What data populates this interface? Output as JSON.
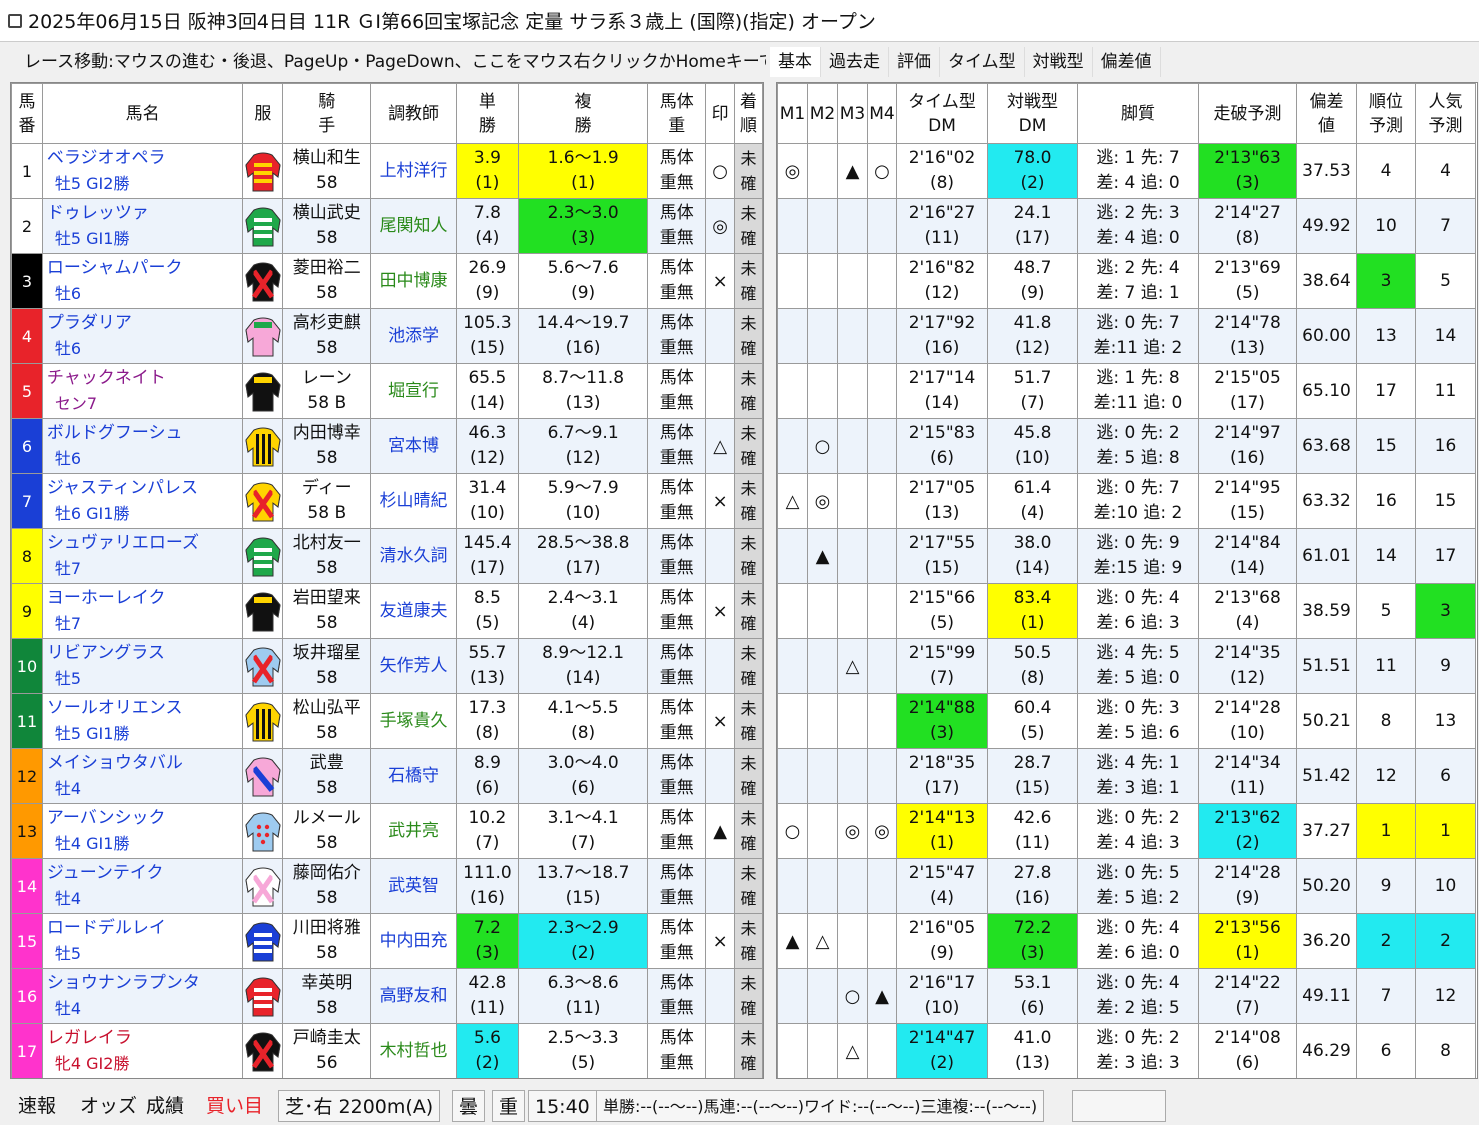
{
  "window": {
    "title": "2025年06月15日 阪神3回4日目 11R ＧⅠ第66回宝塚記念 定量 サラ系３歳上 (国際)(指定) オープン"
  },
  "toolbar": {
    "nav_hint": "レース移動:マウスの進む・後退、PageUp・PageDown、ここをマウス右クリックかHomeキーでレース選択",
    "tabs": [
      "基本",
      "過去走",
      "評価",
      "タイム型",
      "対戦型",
      "偏差値"
    ],
    "active_tab": "基本"
  },
  "left_headers": [
    "馬番",
    "馬名",
    "服",
    "騎手",
    "調教師",
    "単勝",
    "複勝",
    "馬体重",
    "印",
    "着順"
  ],
  "right_headers": [
    "M1",
    "M2",
    "M3",
    "M4",
    "タイム型DM",
    "対戦型DM",
    "脚質",
    "走破予測",
    "偏差値",
    "順位予測",
    "人気予測"
  ],
  "colors": {
    "waku": [
      "#ffffff",
      "#ffffff",
      "#000000",
      "#e8232a",
      "#1a3fd6",
      "#ffff00",
      "#10863a",
      "#ff9900",
      "#ff33cc"
    ],
    "yellow": "#ffff00",
    "green": "#22e022",
    "cyan": "#22eaf0"
  },
  "horses": [
    {
      "no": "1",
      "waku": 1,
      "name": "ベラジオオペラ",
      "sub": "牡5 GI2勝",
      "jockey": "横山和生",
      "kinryo": "58",
      "trainer": "上村洋行",
      "tg": false,
      "tan": "3.9",
      "tanr": "(1)",
      "tan_hl": "y",
      "fuku": "1.6～1.9",
      "fukur": "(1)",
      "fuku_hl": "y",
      "bw1": "馬体",
      "bw2": "重無",
      "mark": "○",
      "m": [
        "◎",
        "",
        "▲",
        "○"
      ],
      "tdm": "2'16\"02",
      "tdmr": "(8)",
      "tdm_hl": "",
      "vdm": "78.0",
      "vdmr": "(2)",
      "vdm_hl": "c",
      "k1": "逃: 1 先: 7",
      "k2": "差: 4 追: 0",
      "so": "2'13\"63",
      "sor": "(3)",
      "so_hl": "g",
      "hen": "37.53",
      "jun": "4",
      "jun_hl": "",
      "nin": "4",
      "nin_hl": "",
      "silk": [
        "#e8232a",
        "#ffd400",
        "h"
      ]
    },
    {
      "no": "2",
      "waku": 1,
      "name": "ドゥレッツァ",
      "sub": "牡5 GI1勝",
      "jockey": "横山武史",
      "kinryo": "58",
      "trainer": "尾関知人",
      "tg": true,
      "tan": "7.8",
      "tanr": "(4)",
      "tan_hl": "",
      "fuku": "2.3～3.0",
      "fukur": "(3)",
      "fuku_hl": "g",
      "bw1": "馬体",
      "bw2": "重無",
      "mark": "◎",
      "m": [
        "",
        "",
        "",
        ""
      ],
      "tdm": "2'16\"27",
      "tdmr": "(11)",
      "tdm_hl": "",
      "vdm": "24.1",
      "vdmr": "(17)",
      "vdm_hl": "",
      "k1": "逃: 2 先: 3",
      "k2": "差: 4 追: 0",
      "so": "2'14\"27",
      "sor": "(8)",
      "so_hl": "",
      "hen": "49.92",
      "jun": "10",
      "jun_hl": "",
      "nin": "7",
      "nin_hl": "",
      "silk": [
        "#1fa84a",
        "#ffffff",
        "h"
      ]
    },
    {
      "no": "3",
      "waku": 2,
      "name": "ローシャムパーク",
      "sub": "牡6",
      "jockey": "菱田裕二",
      "kinryo": "58",
      "trainer": "田中博康",
      "tg": true,
      "tan": "26.9",
      "tanr": "(9)",
      "tan_hl": "",
      "fuku": "5.6～7.6",
      "fukur": "(9)",
      "fuku_hl": "",
      "bw1": "馬体",
      "bw2": "重無",
      "mark": "×",
      "m": [
        "",
        "",
        "",
        ""
      ],
      "tdm": "2'16\"82",
      "tdmr": "(12)",
      "tdm_hl": "",
      "vdm": "48.7",
      "vdmr": "(9)",
      "vdm_hl": "",
      "k1": "逃: 2 先: 4",
      "k2": "差: 7 追: 1",
      "so": "2'13\"69",
      "sor": "(5)",
      "so_hl": "",
      "hen": "38.64",
      "jun": "3",
      "jun_hl": "g",
      "nin": "5",
      "nin_hl": "",
      "silk": [
        "#111111",
        "#e8232a",
        "x"
      ]
    },
    {
      "no": "4",
      "waku": 3,
      "name": "プラダリア",
      "sub": "牡6",
      "jockey": "高杉吏麒",
      "kinryo": "58",
      "trainer": "池添学",
      "tg": false,
      "tan": "105.3",
      "tanr": "(15)",
      "tan_hl": "",
      "fuku": "14.4～19.7",
      "fukur": "(16)",
      "fuku_hl": "",
      "bw1": "馬体",
      "bw2": "重無",
      "mark": "",
      "m": [
        "",
        "",
        "",
        ""
      ],
      "tdm": "2'17\"92",
      "tdmr": "(16)",
      "tdm_hl": "",
      "vdm": "41.8",
      "vdmr": "(12)",
      "vdm_hl": "",
      "k1": "逃: 0 先: 7",
      "k2": "差:11 追: 2",
      "so": "2'14\"78",
      "sor": "(13)",
      "so_hl": "",
      "hen": "60.00",
      "jun": "13",
      "jun_hl": "",
      "nin": "14",
      "nin_hl": "",
      "silk": [
        "#f7a8d8",
        "#1fa84a",
        "s"
      ]
    },
    {
      "no": "5",
      "waku": 3,
      "name": "チャックネイト",
      "sub": "セン7",
      "jockey": "レーン",
      "kinryo": "58 B",
      "trainer": "堀宣行",
      "tg": true,
      "tan": "65.5",
      "tanr": "(14)",
      "tan_hl": "",
      "fuku": "8.7～11.8",
      "fukur": "(13)",
      "fuku_hl": "",
      "bw1": "馬体",
      "bw2": "重無",
      "mark": "",
      "m": [
        "",
        "",
        "",
        ""
      ],
      "tdm": "2'17\"14",
      "tdmr": "(14)",
      "tdm_hl": "",
      "vdm": "51.7",
      "vdmr": "(7)",
      "vdm_hl": "",
      "k1": "逃: 1 先: 8",
      "k2": "差:11 追: 0",
      "so": "2'15\"05",
      "sor": "(17)",
      "so_hl": "",
      "hen": "65.10",
      "jun": "17",
      "jun_hl": "",
      "nin": "11",
      "nin_hl": "",
      "silk": [
        "#111111",
        "#ffd400",
        "s"
      ]
    },
    {
      "no": "6",
      "waku": 4,
      "name": "ボルドグフーシュ",
      "sub": "牡6",
      "jockey": "内田博幸",
      "kinryo": "58",
      "trainer": "宮本博",
      "tg": false,
      "tan": "46.3",
      "tanr": "(12)",
      "tan_hl": "",
      "fuku": "6.7～9.1",
      "fukur": "(12)",
      "fuku_hl": "",
      "bw1": "馬体",
      "bw2": "重無",
      "mark": "△",
      "m": [
        "",
        "○",
        "",
        ""
      ],
      "tdm": "2'15\"83",
      "tdmr": "(6)",
      "tdm_hl": "",
      "vdm": "45.8",
      "vdmr": "(10)",
      "vdm_hl": "",
      "k1": "逃: 0 先: 2",
      "k2": "差: 5 追: 8",
      "so": "2'14\"97",
      "sor": "(16)",
      "so_hl": "",
      "hen": "63.68",
      "jun": "15",
      "jun_hl": "",
      "nin": "16",
      "nin_hl": "",
      "silk": [
        "#ffd400",
        "#111111",
        "v"
      ]
    },
    {
      "no": "7",
      "waku": 4,
      "name": "ジャスティンパレス",
      "sub": "牡6 GI1勝",
      "jockey": "ディー",
      "kinryo": "58 B",
      "trainer": "杉山晴紀",
      "tg": false,
      "tan": "31.4",
      "tanr": "(10)",
      "tan_hl": "",
      "fuku": "5.9～7.9",
      "fukur": "(10)",
      "fuku_hl": "",
      "bw1": "馬体",
      "bw2": "重無",
      "mark": "×",
      "m": [
        "△",
        "◎",
        "",
        ""
      ],
      "tdm": "2'17\"05",
      "tdmr": "(13)",
      "tdm_hl": "",
      "vdm": "61.4",
      "vdmr": "(4)",
      "vdm_hl": "",
      "k1": "逃: 0 先: 7",
      "k2": "差:10 追: 2",
      "so": "2'14\"95",
      "sor": "(15)",
      "so_hl": "",
      "hen": "63.32",
      "jun": "16",
      "jun_hl": "",
      "nin": "15",
      "nin_hl": "",
      "silk": [
        "#ffd400",
        "#e8232a",
        "x"
      ]
    },
    {
      "no": "8",
      "waku": 5,
      "name": "シュヴァリエローズ",
      "sub": "牡7",
      "jockey": "北村友一",
      "kinryo": "58",
      "trainer": "清水久詞",
      "tg": false,
      "tan": "145.4",
      "tanr": "(17)",
      "tan_hl": "",
      "fuku": "28.5～38.8",
      "fukur": "(17)",
      "fuku_hl": "",
      "bw1": "馬体",
      "bw2": "重無",
      "mark": "",
      "m": [
        "",
        "▲",
        "",
        ""
      ],
      "tdm": "2'17\"55",
      "tdmr": "(15)",
      "tdm_hl": "",
      "vdm": "38.0",
      "vdmr": "(14)",
      "vdm_hl": "",
      "k1": "逃: 0 先: 9",
      "k2": "差:15 追: 9",
      "so": "2'14\"84",
      "sor": "(14)",
      "so_hl": "",
      "hen": "61.01",
      "jun": "14",
      "jun_hl": "",
      "nin": "17",
      "nin_hl": "",
      "silk": [
        "#1fa84a",
        "#ffffff",
        "h"
      ]
    },
    {
      "no": "9",
      "waku": 5,
      "name": "ヨーホーレイク",
      "sub": "牡7",
      "jockey": "岩田望来",
      "kinryo": "58",
      "trainer": "友道康夫",
      "tg": false,
      "tan": "8.5",
      "tanr": "(5)",
      "tan_hl": "",
      "fuku": "2.4～3.1",
      "fukur": "(4)",
      "fuku_hl": "",
      "bw1": "馬体",
      "bw2": "重無",
      "mark": "×",
      "m": [
        "",
        "",
        "",
        ""
      ],
      "tdm": "2'15\"66",
      "tdmr": "(5)",
      "tdm_hl": "",
      "vdm": "83.4",
      "vdmr": "(1)",
      "vdm_hl": "y",
      "k1": "逃: 0 先: 4",
      "k2": "差: 6 追: 3",
      "so": "2'13\"68",
      "sor": "(4)",
      "so_hl": "",
      "hen": "38.59",
      "jun": "5",
      "jun_hl": "",
      "nin": "3",
      "nin_hl": "g",
      "silk": [
        "#111111",
        "#ffd400",
        "s"
      ]
    },
    {
      "no": "10",
      "waku": 6,
      "name": "リビアングラス",
      "sub": "牡5",
      "jockey": "坂井瑠星",
      "kinryo": "58",
      "trainer": "矢作芳人",
      "tg": false,
      "tan": "55.7",
      "tanr": "(13)",
      "tan_hl": "",
      "fuku": "8.9～12.1",
      "fukur": "(14)",
      "fuku_hl": "",
      "bw1": "馬体",
      "bw2": "重無",
      "mark": "",
      "m": [
        "",
        "",
        "△",
        ""
      ],
      "tdm": "2'15\"99",
      "tdmr": "(7)",
      "tdm_hl": "",
      "vdm": "50.5",
      "vdmr": "(8)",
      "vdm_hl": "",
      "k1": "逃: 4 先: 5",
      "k2": "差: 5 追: 0",
      "so": "2'14\"35",
      "sor": "(12)",
      "so_hl": "",
      "hen": "51.51",
      "jun": "11",
      "jun_hl": "",
      "nin": "9",
      "nin_hl": "",
      "silk": [
        "#9ecbf0",
        "#e8232a",
        "x"
      ]
    },
    {
      "no": "11",
      "waku": 6,
      "name": "ソールオリエンス",
      "sub": "牡5 GI1勝",
      "jockey": "松山弘平",
      "kinryo": "58",
      "trainer": "手塚貴久",
      "tg": true,
      "tan": "17.3",
      "tanr": "(8)",
      "tan_hl": "",
      "fuku": "4.1～5.5",
      "fukur": "(8)",
      "fuku_hl": "",
      "bw1": "馬体",
      "bw2": "重無",
      "mark": "×",
      "m": [
        "",
        "",
        "",
        ""
      ],
      "tdm": "2'14\"88",
      "tdmr": "(3)",
      "tdm_hl": "g",
      "vdm": "60.4",
      "vdmr": "(5)",
      "vdm_hl": "",
      "k1": "逃: 0 先: 3",
      "k2": "差: 5 追: 6",
      "so": "2'14\"28",
      "sor": "(10)",
      "so_hl": "",
      "hen": "50.21",
      "jun": "8",
      "jun_hl": "",
      "nin": "13",
      "nin_hl": "",
      "silk": [
        "#ffd400",
        "#111111",
        "v"
      ]
    },
    {
      "no": "12",
      "waku": 7,
      "name": "メイショウタバル",
      "sub": "牡4",
      "jockey": "武豊",
      "kinryo": "58",
      "trainer": "石橋守",
      "tg": false,
      "tan": "8.9",
      "tanr": "(6)",
      "tan_hl": "",
      "fuku": "3.0～4.0",
      "fukur": "(6)",
      "fuku_hl": "",
      "bw1": "馬体",
      "bw2": "重無",
      "mark": "",
      "m": [
        "",
        "",
        "",
        ""
      ],
      "tdm": "2'18\"35",
      "tdmr": "(17)",
      "tdm_hl": "",
      "vdm": "28.7",
      "vdmr": "(15)",
      "vdm_hl": "",
      "k1": "逃: 4 先: 1",
      "k2": "差: 3 追: 1",
      "so": "2'14\"34",
      "sor": "(11)",
      "so_hl": "",
      "hen": "51.42",
      "jun": "12",
      "jun_hl": "",
      "nin": "6",
      "nin_hl": "",
      "silk": [
        "#f7a8d8",
        "#1a3fd6",
        "d"
      ]
    },
    {
      "no": "13",
      "waku": 7,
      "name": "アーバンシック",
      "sub": "牡4 GI1勝",
      "jockey": "ルメール",
      "kinryo": "58",
      "trainer": "武井亮",
      "tg": true,
      "tan": "10.2",
      "tanr": "(7)",
      "tan_hl": "",
      "fuku": "3.1～4.1",
      "fukur": "(7)",
      "fuku_hl": "",
      "bw1": "馬体",
      "bw2": "重無",
      "mark": "▲",
      "m": [
        "○",
        "",
        "◎",
        "◎"
      ],
      "tdm": "2'14\"13",
      "tdmr": "(1)",
      "tdm_hl": "y",
      "vdm": "42.6",
      "vdmr": "(11)",
      "vdm_hl": "",
      "k1": "逃: 0 先: 2",
      "k2": "差: 4 追: 3",
      "so": "2'13\"62",
      "sor": "(2)",
      "so_hl": "c",
      "hen": "37.27",
      "jun": "1",
      "jun_hl": "y",
      "nin": "1",
      "nin_hl": "y",
      "silk": [
        "#9ecbf0",
        "#e8232a",
        "o"
      ]
    },
    {
      "no": "14",
      "waku": 8,
      "name": "ジューンテイク",
      "sub": "牡4",
      "jockey": "藤岡佑介",
      "kinryo": "58",
      "trainer": "武英智",
      "tg": false,
      "tan": "111.0",
      "tanr": "(16)",
      "tan_hl": "",
      "fuku": "13.7～18.7",
      "fukur": "(15)",
      "fuku_hl": "",
      "bw1": "馬体",
      "bw2": "重無",
      "mark": "",
      "m": [
        "",
        "",
        "",
        ""
      ],
      "tdm": "2'15\"47",
      "tdmr": "(4)",
      "tdm_hl": "",
      "vdm": "27.8",
      "vdmr": "(16)",
      "vdm_hl": "",
      "k1": "逃: 0 先: 5",
      "k2": "差: 5 追: 2",
      "so": "2'14\"28",
      "sor": "(9)",
      "so_hl": "",
      "hen": "50.20",
      "jun": "9",
      "jun_hl": "",
      "nin": "10",
      "nin_hl": "",
      "silk": [
        "#ffffff",
        "#f7a8d8",
        "x"
      ]
    },
    {
      "no": "15",
      "waku": 8,
      "name": "ロードデルレイ",
      "sub": "牡5",
      "jockey": "川田将雅",
      "kinryo": "58",
      "trainer": "中内田充",
      "tg": false,
      "tan": "7.2",
      "tanr": "(3)",
      "tan_hl": "g",
      "fuku": "2.3～2.9",
      "fukur": "(2)",
      "fuku_hl": "c",
      "bw1": "馬体",
      "bw2": "重無",
      "mark": "×",
      "m": [
        "▲",
        "△",
        "",
        ""
      ],
      "tdm": "2'16\"05",
      "tdmr": "(9)",
      "tdm_hl": "",
      "vdm": "72.2",
      "vdmr": "(3)",
      "vdm_hl": "g",
      "k1": "逃: 0 先: 4",
      "k2": "差: 6 追: 0",
      "so": "2'13\"56",
      "sor": "(1)",
      "so_hl": "y",
      "hen": "36.20",
      "jun": "2",
      "jun_hl": "c",
      "nin": "2",
      "nin_hl": "c",
      "silk": [
        "#1a3fd6",
        "#ffffff",
        "h"
      ]
    },
    {
      "no": "16",
      "waku": 8,
      "name": "ショウナンラプンタ",
      "sub": "牡4",
      "jockey": "幸英明",
      "kinryo": "58",
      "trainer": "高野友和",
      "tg": false,
      "tan": "42.8",
      "tanr": "(11)",
      "tan_hl": "",
      "fuku": "6.3～8.6",
      "fukur": "(11)",
      "fuku_hl": "",
      "bw1": "馬体",
      "bw2": "重無",
      "mark": "",
      "m": [
        "",
        "",
        "○",
        "▲"
      ],
      "tdm": "2'16\"17",
      "tdmr": "(10)",
      "tdm_hl": "",
      "vdm": "53.1",
      "vdmr": "(6)",
      "vdm_hl": "",
      "k1": "逃: 0 先: 4",
      "k2": "差: 2 追: 5",
      "so": "2'14\"22",
      "sor": "(7)",
      "so_hl": "",
      "hen": "49.11",
      "jun": "7",
      "jun_hl": "",
      "nin": "12",
      "nin_hl": "",
      "silk": [
        "#e8232a",
        "#ffffff",
        "h"
      ]
    },
    {
      "no": "17",
      "waku": 8,
      "name": "レガレイラ",
      "sub": "牝4 GI2勝",
      "jockey": "戸崎圭太",
      "kinryo": "56",
      "trainer": "木村哲也",
      "tg": true,
      "tan": "5.6",
      "tanr": "(2)",
      "tan_hl": "c",
      "fuku": "2.5～3.3",
      "fukur": "(5)",
      "fuku_hl": "",
      "bw1": "馬体",
      "bw2": "重無",
      "mark": "",
      "m": [
        "",
        "",
        "△",
        ""
      ],
      "tdm": "2'14\"47",
      "tdmr": "(2)",
      "tdm_hl": "c",
      "vdm": "41.0",
      "vdmr": "(13)",
      "vdm_hl": "",
      "k1": "逃: 0 先: 2",
      "k2": "差: 3 追: 3",
      "so": "2'14\"08",
      "sor": "(6)",
      "so_hl": "",
      "hen": "46.29",
      "jun": "6",
      "jun_hl": "",
      "nin": "8",
      "nin_hl": "",
      "silk": [
        "#111111",
        "#e8232a",
        "x"
      ]
    }
  ],
  "chaku": [
    "未",
    "確"
  ],
  "status": {
    "links": [
      "速報",
      "オッズ",
      "成績",
      "買い目"
    ],
    "course": "芝･右 2200m(A)",
    "weather": "曇",
    "track": "重",
    "time": "15:40",
    "payout": "単勝:--(--～--)馬連:--(--～--)ワイド:--(--～--)三連複:--(--～--)"
  }
}
